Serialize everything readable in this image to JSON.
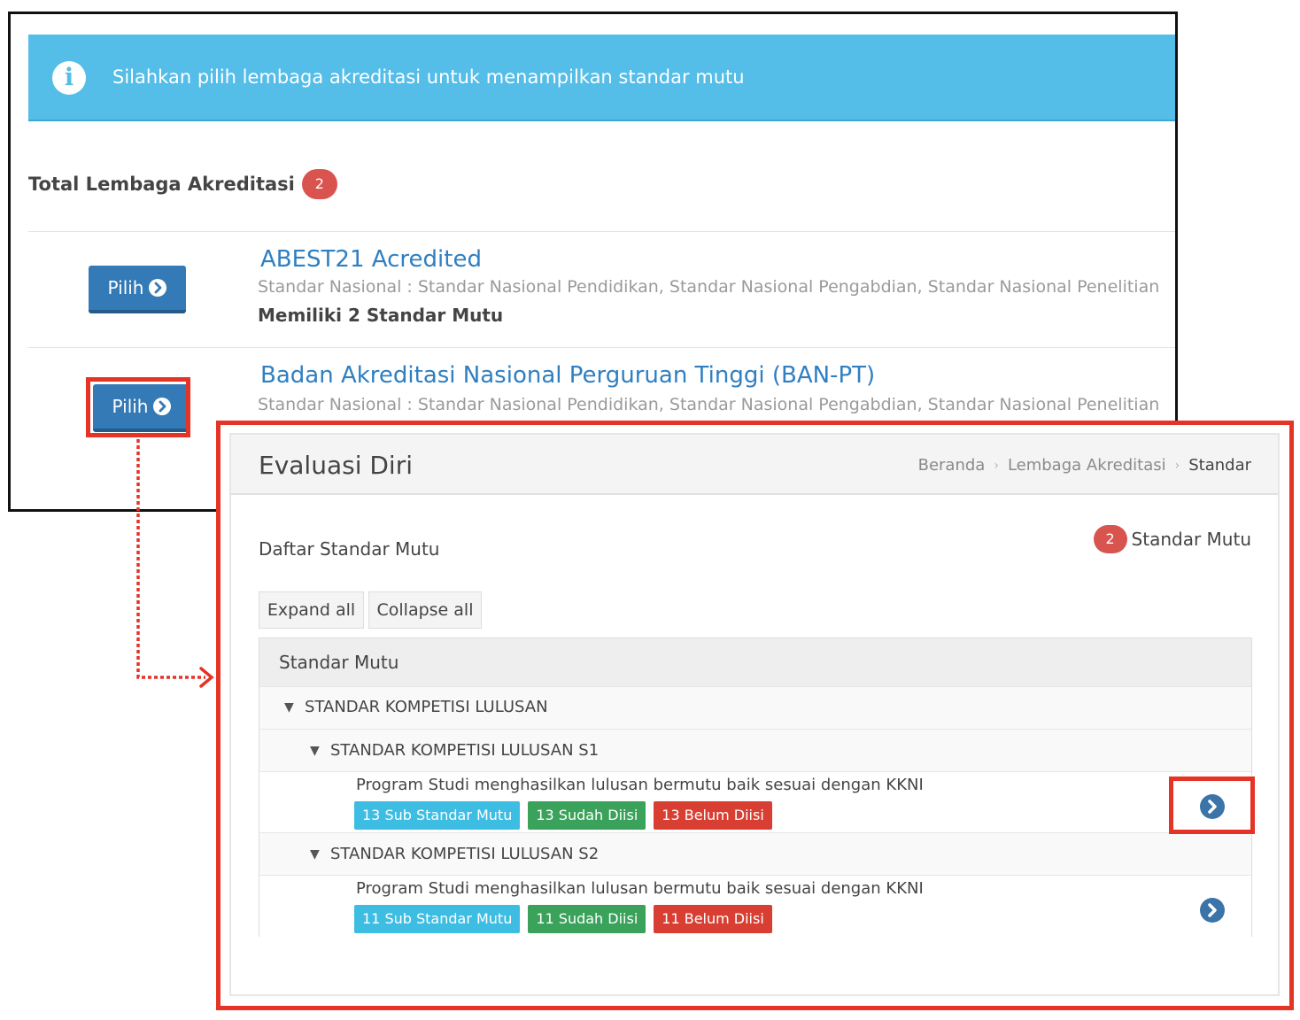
{
  "accreditation": {
    "alert_text": "Silahkan pilih lembaga akreditasi untuk menampilkan standar mutu",
    "total_label": "Total Lembaga Akreditasi",
    "total_count": "2",
    "items": [
      {
        "button_label": "Pilih",
        "title": "ABEST21 Acredited",
        "standards": "Standar Nasional : Standar Nasional Pendidikan, Standar Nasional Pengabdian, Standar Nasional Penelitian",
        "count_text": "Memiliki 2 Standar Mutu"
      },
      {
        "button_label": "Pilih",
        "title": "Badan Akreditasi Nasional Perguruan Tinggi (BAN-PT)",
        "standards": "Standar Nasional : Standar Nasional Pendidikan, Standar Nasional Pengabdian, Standar Nasional Penelitian"
      }
    ]
  },
  "evaluasi": {
    "page_title": "Evaluasi Diri",
    "breadcrumb": [
      "Beranda",
      "Lembaga Akreditasi",
      "Standar"
    ],
    "list_label": "Daftar Standar Mutu",
    "count": "2",
    "count_label": "Standar Mutu",
    "expand_label": "Expand all",
    "collapse_label": "Collapse all",
    "table_header": "Standar Mutu",
    "root_group": "STANDAR KOMPETISI LULUSAN",
    "subgroups": [
      {
        "label": "STANDAR KOMPETISI LULUSAN S1",
        "item_text": "Program Studi menghasilkan lulusan bermutu baik sesuai dengan KKNI",
        "sub_standar": "13 Sub Standar Mutu",
        "sudah": "13 Sudah Diisi",
        "belum": "13 Belum Diisi"
      },
      {
        "label": "STANDAR KOMPETISI LULUSAN S2",
        "item_text": "Program Studi menghasilkan lulusan bermutu baik sesuai dengan KKNI",
        "sub_standar": "11 Sub Standar Mutu",
        "sudah": "11 Sudah Diisi",
        "belum": "11 Belum Diisi"
      }
    ]
  },
  "icons": {
    "info": "info-circle-icon",
    "chevron": "chevron-circle-right-icon",
    "toggle": "caret-down-icon",
    "breadcrumb_separator": "chevron-right-icon"
  },
  "colors": {
    "info_alert": "#54bde8",
    "primary_button": "#337ab7",
    "highlight": "#e53326",
    "badge_red": "#d9534f",
    "label_info": "#3ebde3",
    "label_success": "#3aa25a",
    "label_danger": "#d83f32"
  }
}
